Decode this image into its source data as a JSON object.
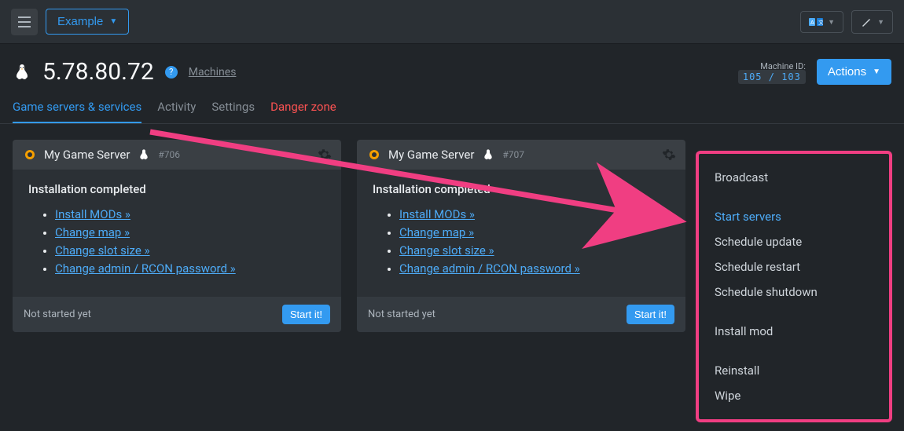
{
  "topbar": {
    "example_label": "Example"
  },
  "header": {
    "ip": "5.78.80.72",
    "breadcrumb": "Machines",
    "machine_id_label": "Machine ID:",
    "machine_id_value": "105 / 103",
    "actions_label": "Actions"
  },
  "tabs": {
    "game_servers": "Game servers & services",
    "activity": "Activity",
    "settings": "Settings",
    "danger": "Danger zone"
  },
  "cards": [
    {
      "title": "My Game Server",
      "id": "#706",
      "status_title": "Installation completed",
      "links": {
        "mods": "Install MODs »",
        "map": "Change map »",
        "slot": "Change slot size »",
        "rcon": "Change admin / RCON password »"
      },
      "footer_status": "Not started yet",
      "start_label": "Start it!"
    },
    {
      "title": "My Game Server",
      "id": "#707",
      "status_title": "Installation completed",
      "links": {
        "mods": "Install MODs »",
        "map": "Change map »",
        "slot": "Change slot size »",
        "rcon": "Change admin / RCON password »"
      },
      "footer_status": "Not started yet",
      "start_label": "Start it!"
    }
  ],
  "menu": {
    "group1": {
      "broadcast": "Broadcast"
    },
    "group2": {
      "start": "Start servers",
      "update": "Schedule update",
      "restart": "Schedule restart",
      "shutdown": "Schedule shutdown"
    },
    "group3": {
      "install_mod": "Install mod"
    },
    "group4": {
      "reinstall": "Reinstall",
      "wipe": "Wipe"
    }
  }
}
